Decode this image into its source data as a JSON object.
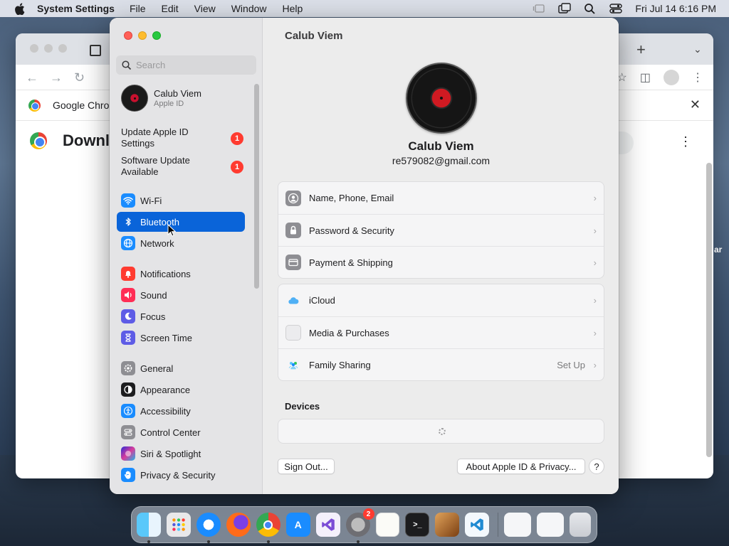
{
  "menubar": {
    "app_name": "System Settings",
    "menus": [
      "File",
      "Edit",
      "View",
      "Window",
      "Help"
    ],
    "clock": "Fri Jul 14  6:16 PM",
    "status_icons": [
      "stage-manager-icon",
      "screen-mirroring-icon",
      "spotlight-icon",
      "control-center-icon"
    ]
  },
  "chrome_window": {
    "infobar_text": "Google Chron",
    "page_title": "Downl",
    "peek_text": "ar"
  },
  "sidebar": {
    "search_placeholder": "Search",
    "profile": {
      "name": "Calub Viem",
      "subtitle": "Apple ID"
    },
    "notices": [
      {
        "label": "Update Apple ID Settings",
        "badge": "1"
      },
      {
        "label": "Software Update Available",
        "badge": "1"
      }
    ],
    "items": [
      {
        "label": "Wi-Fi",
        "icon": "wifi-icon",
        "color": "#1a8cff"
      },
      {
        "label": "Bluetooth",
        "icon": "bluetooth-icon",
        "color": "#1a8cff",
        "selected": true
      },
      {
        "label": "Network",
        "icon": "globe-icon",
        "color": "#1a8cff"
      },
      {
        "label": "Notifications",
        "icon": "bell-icon",
        "color": "#ff3b30"
      },
      {
        "label": "Sound",
        "icon": "speaker-icon",
        "color": "#ff2d55"
      },
      {
        "label": "Focus",
        "icon": "moon-icon",
        "color": "#5e5ce6"
      },
      {
        "label": "Screen Time",
        "icon": "hourglass-icon",
        "color": "#5e5ce6"
      },
      {
        "label": "General",
        "icon": "gear-icon",
        "color": "#8e8e93"
      },
      {
        "label": "Appearance",
        "icon": "appearance-icon",
        "color": "#1d1d1f"
      },
      {
        "label": "Accessibility",
        "icon": "accessibility-icon",
        "color": "#1a8cff"
      },
      {
        "label": "Control Center",
        "icon": "control-center-icon",
        "color": "#8e8e93"
      },
      {
        "label": "Siri & Spotlight",
        "icon": "siri-icon",
        "color": "#a24bd9"
      },
      {
        "label": "Privacy & Security",
        "icon": "hand-icon",
        "color": "#1a8cff"
      }
    ]
  },
  "main": {
    "title": "Calub Viem",
    "user_name": "Calub Viem",
    "user_email": "re579082@gmail.com",
    "group1": [
      {
        "label": "Name, Phone, Email",
        "icon": "person-icon"
      },
      {
        "label": "Password & Security",
        "icon": "lock-icon"
      },
      {
        "label": "Payment & Shipping",
        "icon": "card-icon"
      }
    ],
    "group2": [
      {
        "label": "iCloud",
        "icon": "icloud-icon",
        "value": ""
      },
      {
        "label": "Media & Purchases",
        "icon": "media-icon",
        "value": ""
      },
      {
        "label": "Family Sharing",
        "icon": "family-icon",
        "value": "Set Up"
      }
    ],
    "devices_heading": "Devices",
    "sign_out_label": "Sign Out...",
    "about_label": "About Apple ID & Privacy...",
    "help_label": "?"
  },
  "dock": {
    "apps": [
      "Finder",
      "Launchpad",
      "Safari",
      "Firefox",
      "Google Chrome",
      "App Store",
      "Visual Studio",
      "System Settings",
      "TextEdit",
      "Terminal",
      "GarageBand",
      "Visual Studio Code"
    ],
    "system_settings_badge": "2"
  }
}
